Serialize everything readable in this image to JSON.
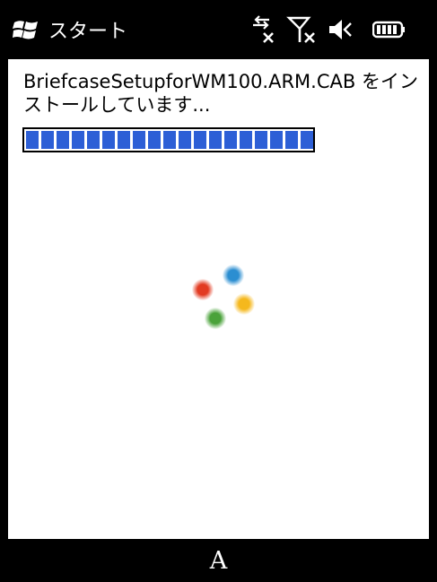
{
  "status_bar": {
    "start_label": "スタート",
    "icons": [
      "windows-logo-icon",
      "data-connection-icon",
      "no-signal-icon",
      "speaker-muted-icon",
      "battery-icon"
    ]
  },
  "main": {
    "message": "BriefcaseSetupforWM100.ARM.CAB をインストールしています...",
    "progress_segments": 19,
    "progress_color": "#2d5fd6",
    "busy_indicator_colors": [
      "#e23b22",
      "#2b8ed1",
      "#f5b81d",
      "#4aa23a"
    ]
  },
  "bottom_bar": {
    "sip_label": "A"
  }
}
